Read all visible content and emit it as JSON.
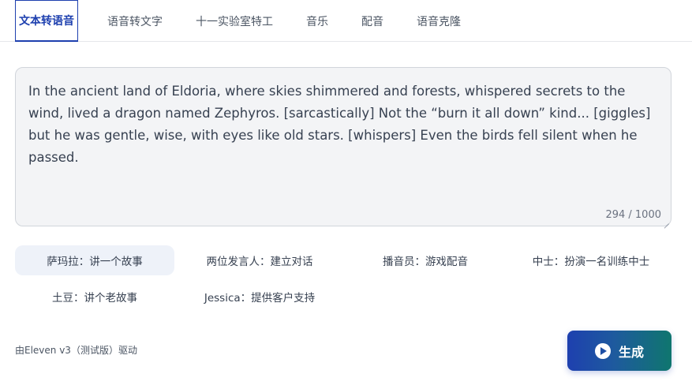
{
  "tabs": [
    {
      "label": "文本转语音",
      "active": true
    },
    {
      "label": "语音转文字",
      "active": false
    },
    {
      "label": "十一实验室特工",
      "active": false
    },
    {
      "label": "音乐",
      "active": false
    },
    {
      "label": "配音",
      "active": false
    },
    {
      "label": "语音克隆",
      "active": false
    }
  ],
  "editor": {
    "text": "In the ancient land of Eldoria, where skies shimmered and forests, whispered secrets to the wind, lived a dragon named Zephyros. [sarcastically] Not the “burn it all down” kind... [giggles] but he was gentle, wise, with eyes like old stars. [whispers] Even the birds fell silent when he passed.",
    "counter": "294 / 1000"
  },
  "presets": [
    {
      "label": "萨玛拉：讲一个故事",
      "selected": true
    },
    {
      "label": "两位发言人：建立对话",
      "selected": false
    },
    {
      "label": "播音员：游戏配音",
      "selected": false
    },
    {
      "label": "中士：扮演一名训练中士",
      "selected": false
    },
    {
      "label": "土豆：讲个老故事",
      "selected": false
    },
    {
      "label": "Jessica：提供客户支持",
      "selected": false
    }
  ],
  "footer": {
    "powered_by": "由Eleven v3（测试版）驱动"
  },
  "generate": {
    "label": "生成"
  },
  "colors": {
    "accent": "#1e40af",
    "gradient_end": "#0f766e"
  }
}
